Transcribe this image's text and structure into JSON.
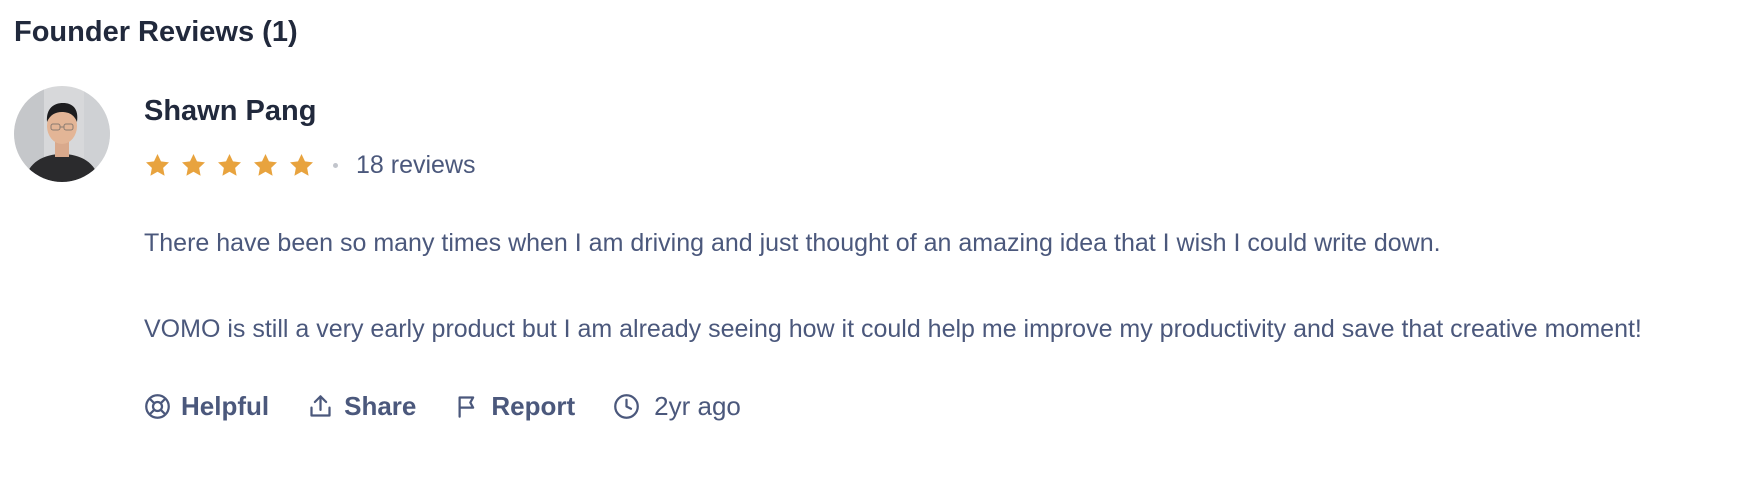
{
  "section": {
    "title": "Founder Reviews (1)"
  },
  "review": {
    "author": {
      "name": "Shawn Pang",
      "avatar_icon": "person-photo"
    },
    "rating": {
      "stars": 5,
      "max": 5,
      "star_color": "#e8a33e",
      "review_count": "18 reviews"
    },
    "paragraphs": [
      "There have been so many times when I am driving and just thought of an amazing idea that I wish I could write down.",
      "VOMO is still a very early product but I am already seeing how it could help me improve my productivity and save that creative moment!"
    ],
    "actions": {
      "helpful": "Helpful",
      "helpful_icon": "lifebuoy-icon",
      "share": "Share",
      "share_icon": "share-icon",
      "report": "Report",
      "report_icon": "flag-icon",
      "time": "2yr ago",
      "time_icon": "clock-icon"
    }
  },
  "colors": {
    "heading": "#21293c",
    "body_text": "#4b587c",
    "star": "#e8a33e"
  }
}
